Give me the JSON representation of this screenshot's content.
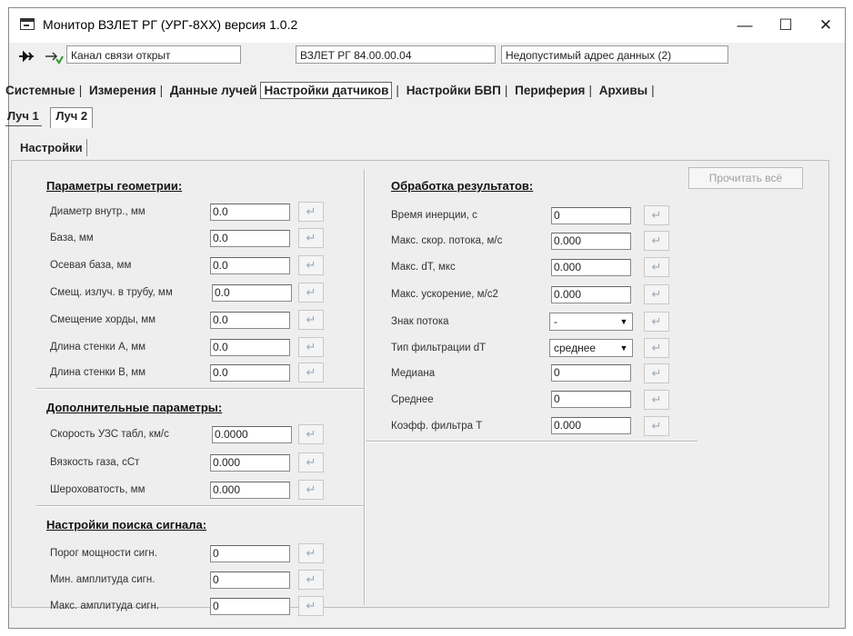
{
  "window": {
    "title": "Монитор ВЗЛЕТ РГ (УРГ-8ХХ) версия 1.0.2",
    "minimize": "—",
    "maximize": "☐",
    "close": "✕"
  },
  "toolbar": {
    "disconnect_icon": "plug-icon",
    "connect_icon": "arrow-connect-icon",
    "channel_status": "Канал связи открыт",
    "device": "ВЗЛЕТ РГ 84.00.00.04",
    "error": "Недопустимый адрес данных (2)"
  },
  "tabs": {
    "main": [
      "Системные",
      "Измерения",
      "Данные лучей",
      "Настройки датчиков",
      "Настройки БВП",
      "Периферия",
      "Архивы"
    ],
    "active": "Настройки датчиков",
    "beams": [
      "Луч 1",
      "Луч 2"
    ],
    "sub": "Настройки"
  },
  "read_all_button": "Прочитать всё",
  "geometry": {
    "title": "Параметры геометрии:",
    "fields": [
      {
        "label": "Диаметр внутр., мм",
        "value": "0.0"
      },
      {
        "label": "База, мм",
        "value": "0.0"
      },
      {
        "label": "Осевая база, мм",
        "value": "0.0"
      },
      {
        "label": "Смещ. излуч. в трубу, мм",
        "value": "0.0"
      },
      {
        "label": "Смещение хорды, мм",
        "value": "0.0"
      },
      {
        "label": "Длина стенки А, мм",
        "value": "0.0"
      },
      {
        "label": "Длина стенки В, мм",
        "value": "0.0"
      }
    ]
  },
  "additional": {
    "title": "Дополнительные параметры:",
    "fields": [
      {
        "label": "Скорость УЗС табл, км/с",
        "value": "0.0000"
      },
      {
        "label": "Вязкость газа, сСт",
        "value": "0.000"
      },
      {
        "label": "Шероховатость, мм",
        "value": "0.000"
      }
    ]
  },
  "signal": {
    "title": "Настройки поиска сигнала:",
    "fields": [
      {
        "label": "Порог мощности сигн.",
        "value": "0"
      },
      {
        "label": "Мин. амплитуда сигн.",
        "value": "0"
      },
      {
        "label": "Макс. амплитуда сигн.",
        "value": "0"
      }
    ]
  },
  "processing": {
    "title": "Обработка результатов:",
    "fields": [
      {
        "label": "Время инерции, с",
        "value": "0"
      },
      {
        "label": "Макс. скор. потока, м/с",
        "value": "0.000"
      },
      {
        "label": "Макс. dT, мкс",
        "value": "0.000"
      },
      {
        "label": "Макс. ускорение, м/с2",
        "value": "0.000"
      },
      {
        "label": "Знак потока",
        "value": "-"
      },
      {
        "label": "Тип фильтрации dT",
        "value": "среднее"
      },
      {
        "label": "Медиана",
        "value": "0"
      },
      {
        "label": "Среднее",
        "value": "0"
      },
      {
        "label": "Коэфф. фильтра Т",
        "value": "0.000"
      }
    ]
  },
  "apply_glyph": "↵"
}
